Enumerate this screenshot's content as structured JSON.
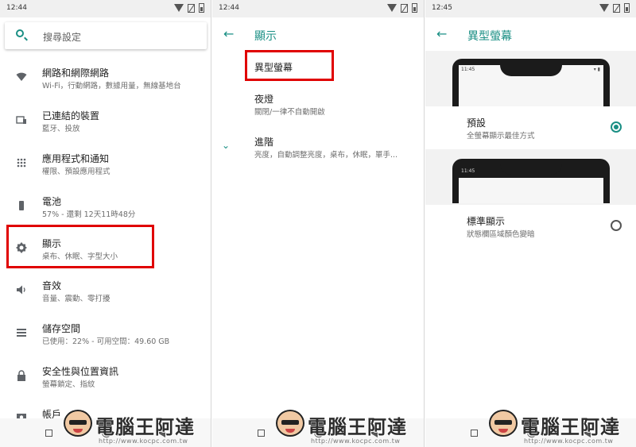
{
  "colors": {
    "accent": "#1a8f84",
    "highlight": "#e00000"
  },
  "panel1": {
    "status_time": "12:44",
    "search_placeholder": "搜尋設定",
    "items": [
      {
        "title": "網路和網際網路",
        "subtitle": "Wi-Fi，行動網路，數據用量，無線基地台",
        "icon": "wifi-icon"
      },
      {
        "title": "已連結的裝置",
        "subtitle": "藍牙、投放",
        "icon": "devices-icon"
      },
      {
        "title": "應用程式和通知",
        "subtitle": "權限、預設應用程式",
        "icon": "apps-icon"
      },
      {
        "title": "電池",
        "subtitle": "57% - 還剩 12天11時48分",
        "icon": "battery-icon"
      },
      {
        "title": "顯示",
        "subtitle": "桌布、休眠、字型大小",
        "icon": "brightness-icon"
      },
      {
        "title": "音效",
        "subtitle": "音量、震動、零打擾",
        "icon": "volume-icon"
      },
      {
        "title": "儲存空間",
        "subtitle": "已使用：22% - 可用空間：49.60 GB",
        "icon": "storage-icon"
      },
      {
        "title": "安全性與位置資訊",
        "subtitle": "螢幕鎖定、指紋",
        "icon": "lock-icon"
      },
      {
        "title": "帳戶",
        "subtitle": "",
        "icon": "account-icon"
      }
    ]
  },
  "panel2": {
    "status_time": "12:44",
    "title": "顯示",
    "items": [
      {
        "title": "異型螢幕",
        "subtitle": ""
      },
      {
        "title": "夜燈",
        "subtitle": "關閉/一律不自動開啟"
      },
      {
        "title": "進階",
        "subtitle": "亮度，自動調整亮度，桌布，休眠，單手..."
      }
    ]
  },
  "panel3": {
    "status_time": "12:45",
    "title": "異型螢幕",
    "preview_time": "11:45",
    "options": [
      {
        "title": "預設",
        "subtitle": "全螢幕顯示最佳方式",
        "selected": true
      },
      {
        "title": "標準顯示",
        "subtitle": "狀態欄區域顏色變暗",
        "selected": false
      }
    ]
  },
  "watermark": {
    "brand": "電腦王阿達",
    "url": "http://www.kocpc.com.tw"
  }
}
